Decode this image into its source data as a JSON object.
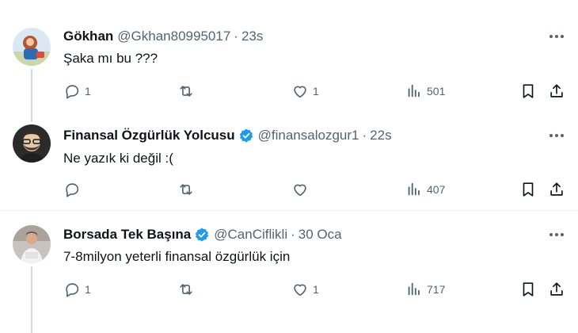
{
  "tweets": [
    {
      "name": "Gökhan",
      "handle": "@Gkhan80995017",
      "time": "23s",
      "text": "Şaka mı bu ???",
      "replies": "1",
      "retweets": "",
      "likes": "1",
      "views": "501",
      "verified": false
    },
    {
      "name": "Finansal Özgürlük Yolcusu",
      "handle": "@finansalozgur1",
      "time": "22s",
      "text": "Ne yazık ki değil :(",
      "replies": "",
      "retweets": "",
      "likes": "",
      "views": "407",
      "verified": true
    },
    {
      "name": "Borsada Tek Başına",
      "handle": "@CanCiflikli",
      "time": "30 Oca",
      "text": "7-8milyon yeterli finansal özgürlük için",
      "replies": "1",
      "retweets": "",
      "likes": "1",
      "views": "717",
      "verified": true
    }
  ],
  "separator": "·",
  "colors": {
    "text": "#0f1419",
    "secondary": "#536471",
    "verified": "#1d9bf0",
    "thread_line": "#cfd9de",
    "divider": "#eff3f4"
  },
  "icons": [
    "reply-icon",
    "retweet-icon",
    "like-icon",
    "views-icon",
    "bookmark-icon",
    "share-icon",
    "more-icon",
    "verified-badge-icon"
  ]
}
